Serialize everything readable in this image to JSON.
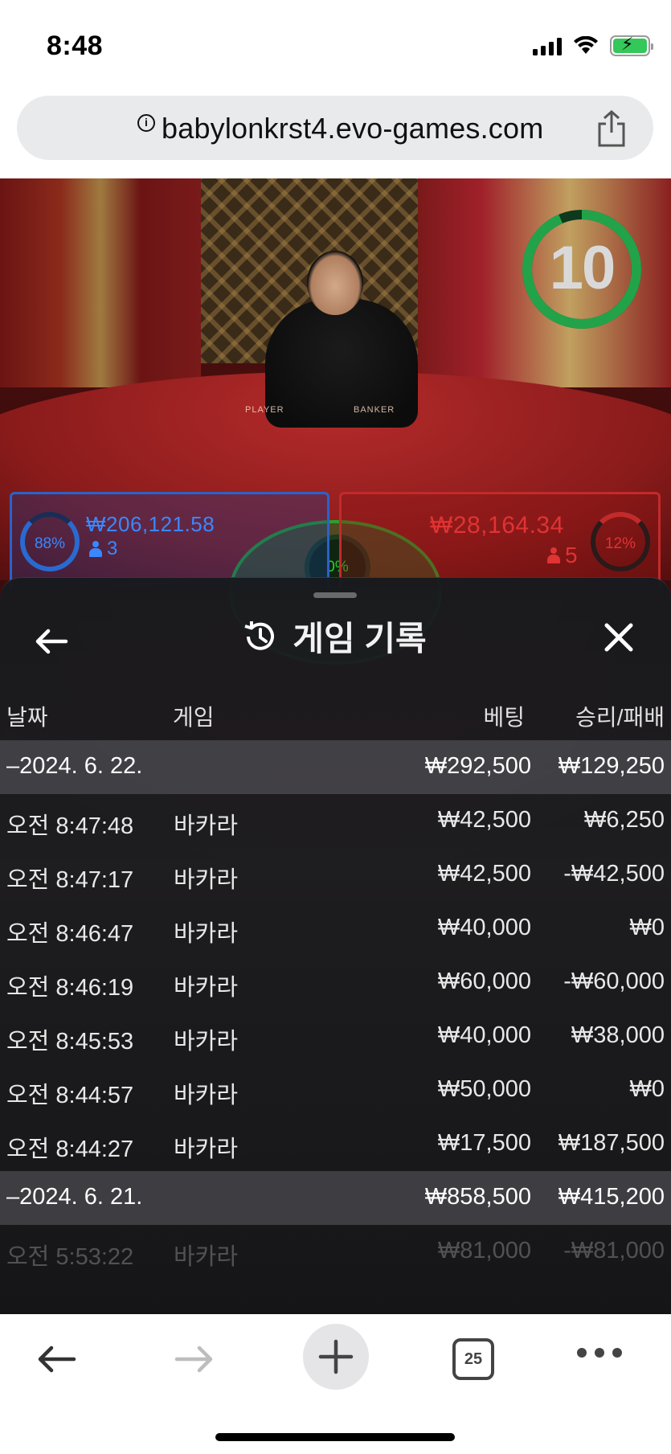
{
  "status_bar": {
    "time": "8:48"
  },
  "url_bar": {
    "url": "babylonkrst4.evo-games.com"
  },
  "game": {
    "timer": "10",
    "player": {
      "percent": "88%",
      "amount": "₩206,121.58",
      "players": "3"
    },
    "banker": {
      "percent": "12%",
      "amount": "₩28,164.34",
      "players": "5"
    },
    "tie": {
      "percent": "0%"
    }
  },
  "history": {
    "title": "게임 기록",
    "columns": {
      "date": "날짜",
      "game": "게임",
      "bet": "베팅",
      "win_loss": "승리/패배"
    },
    "groups": [
      {
        "date": "–2024. 6. 22.",
        "bet_total": "₩292,500",
        "win_total": "₩129,250",
        "rows": [
          {
            "time": "오전 8:47:48",
            "game": "바카라",
            "bet": "₩42,500",
            "win": "₩6,250"
          },
          {
            "time": "오전 8:47:17",
            "game": "바카라",
            "bet": "₩42,500",
            "win": "-₩42,500"
          },
          {
            "time": "오전 8:46:47",
            "game": "바카라",
            "bet": "₩40,000",
            "win": "₩0"
          },
          {
            "time": "오전 8:46:19",
            "game": "바카라",
            "bet": "₩60,000",
            "win": "-₩60,000"
          },
          {
            "time": "오전 8:45:53",
            "game": "바카라",
            "bet": "₩40,000",
            "win": "₩38,000"
          },
          {
            "time": "오전 8:44:57",
            "game": "바카라",
            "bet": "₩50,000",
            "win": "₩0"
          },
          {
            "time": "오전 8:44:27",
            "game": "바카라",
            "bet": "₩17,500",
            "win": "₩187,500"
          }
        ]
      },
      {
        "date": "–2024. 6. 21.",
        "bet_total": "₩858,500",
        "win_total": "₩415,200",
        "rows": [
          {
            "time": "오전 5:53:22",
            "game": "바카라",
            "bet": "₩81,000",
            "win": "-₩81,000"
          }
        ]
      }
    ]
  },
  "toolbar": {
    "tab_count": "25"
  },
  "colors": {
    "player": "#3a88ff",
    "banker": "#e03333",
    "tie": "#2bd02b",
    "timer": "#22a34a"
  },
  "icons": [
    "info-icon",
    "share-icon",
    "back-arrow-icon",
    "history-icon",
    "close-icon",
    "browser-back-icon",
    "browser-forward-icon",
    "new-tab-icon",
    "tabs-icon",
    "more-icon"
  ]
}
